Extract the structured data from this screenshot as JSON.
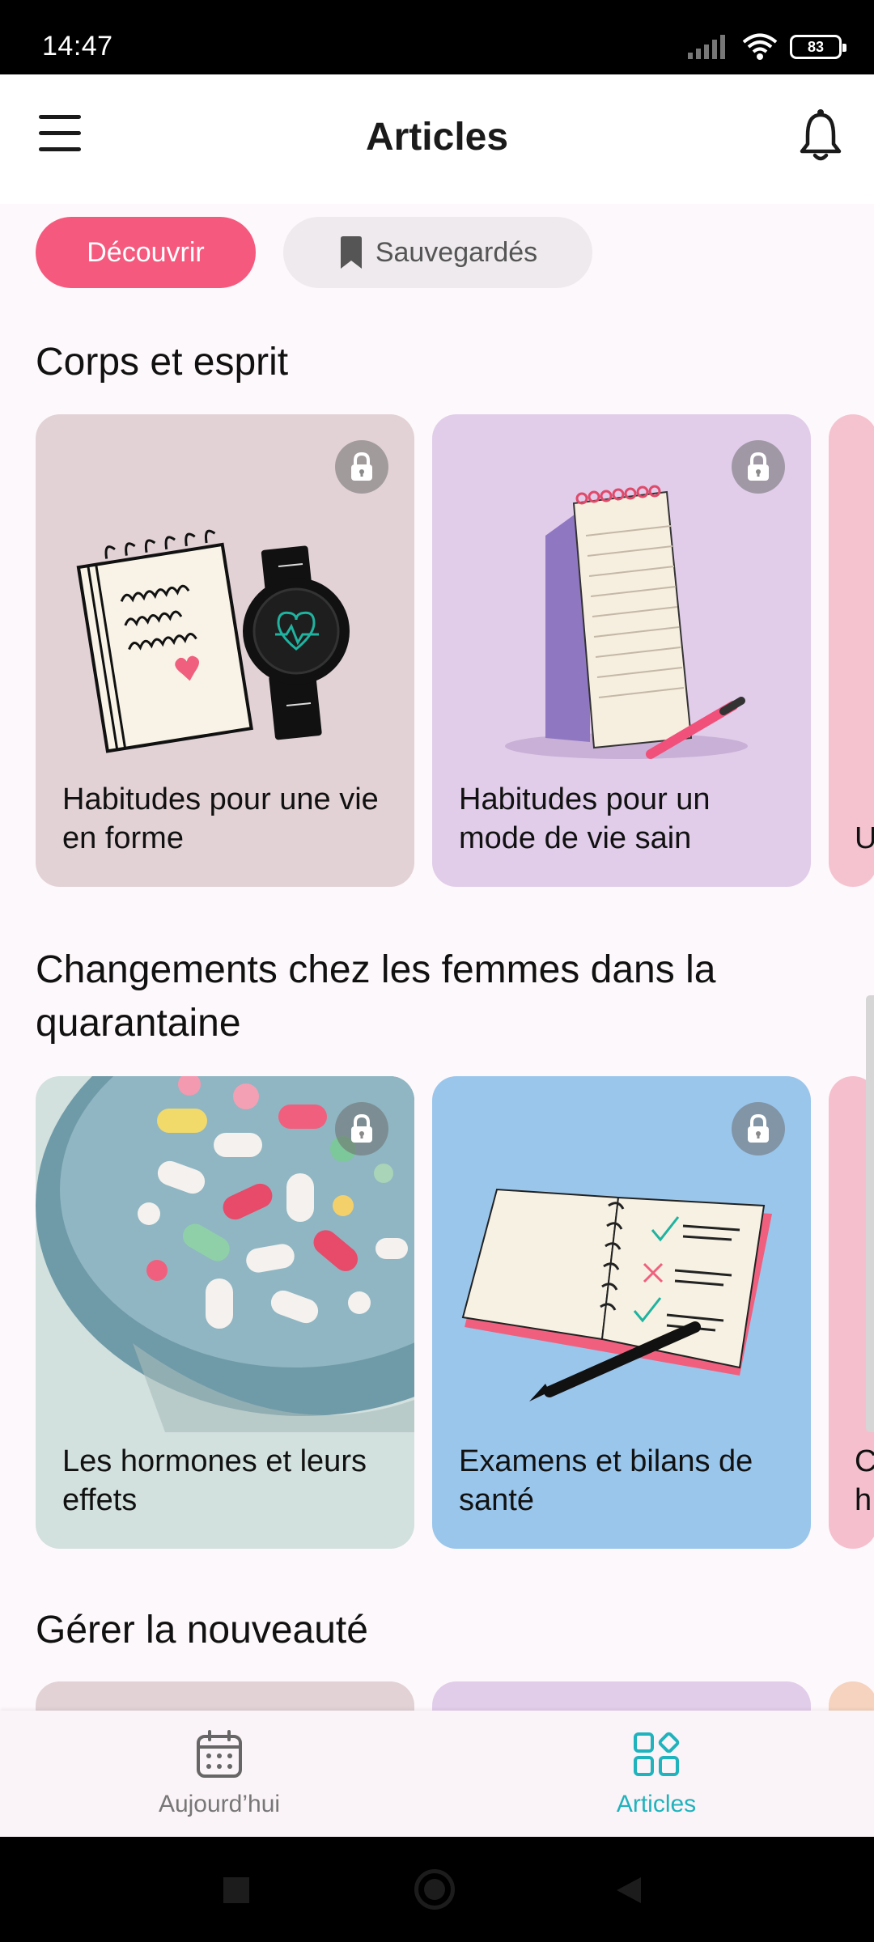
{
  "status_bar": {
    "time": "14:47",
    "battery": "83"
  },
  "header": {
    "title": "Articles"
  },
  "segments": {
    "discover": "Découvrir",
    "saved": "Sauvegardés"
  },
  "sections": [
    {
      "title": "Corps et esprit",
      "cards": [
        {
          "title": "Habitudes pour une vie en forme",
          "bg": "#e2d2d6",
          "locked": true
        },
        {
          "title": "Habitudes pour un mode de vie sain",
          "bg": "#e1cdea",
          "locked": true
        },
        {
          "title": "U",
          "bg": "#f5c3d0"
        }
      ]
    },
    {
      "title": "Changements chez les femmes dans la quarantaine",
      "cards": [
        {
          "title": "Les hormones et leurs effets",
          "bg": "#d2e0de",
          "locked": true
        },
        {
          "title": "Examens et bilans de santé",
          "bg": "#9ac6ec",
          "locked": true
        },
        {
          "title": "C h",
          "bg": "#f5bfcd"
        }
      ]
    },
    {
      "title": "Gérer la nouveauté"
    }
  ],
  "bottom_nav": {
    "today": {
      "label": "Aujourd’hui",
      "icon": "calendar-icon"
    },
    "articles": {
      "label": "Articles",
      "icon": "grid-icon",
      "active_color": "#1fb3bd"
    }
  },
  "colors": {
    "accent": "#f55a7e",
    "teal": "#1fb3bd"
  }
}
